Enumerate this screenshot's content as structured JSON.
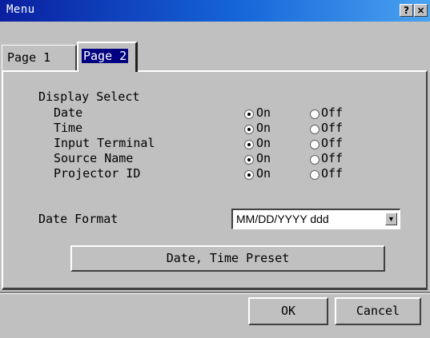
{
  "window": {
    "title": "Menu",
    "help_label": "?",
    "close_label": "×"
  },
  "tabs": [
    {
      "label": "Page 1",
      "selected": false
    },
    {
      "label": "Page 2",
      "selected": true
    }
  ],
  "display_select": {
    "heading": "Display Select",
    "on_label": "On",
    "off_label": "Off",
    "items": [
      {
        "label": "Date",
        "value": "On"
      },
      {
        "label": "Time",
        "value": "On"
      },
      {
        "label": "Input Terminal",
        "value": "On"
      },
      {
        "label": "Source Name",
        "value": "On"
      },
      {
        "label": "Projector ID",
        "value": "On"
      }
    ]
  },
  "date_format": {
    "label": "Date Format",
    "value": "MM/DD/YYYY ddd"
  },
  "preset_button": "Date, Time Preset",
  "footer": {
    "ok_label": "OK",
    "cancel_label": "Cancel"
  }
}
